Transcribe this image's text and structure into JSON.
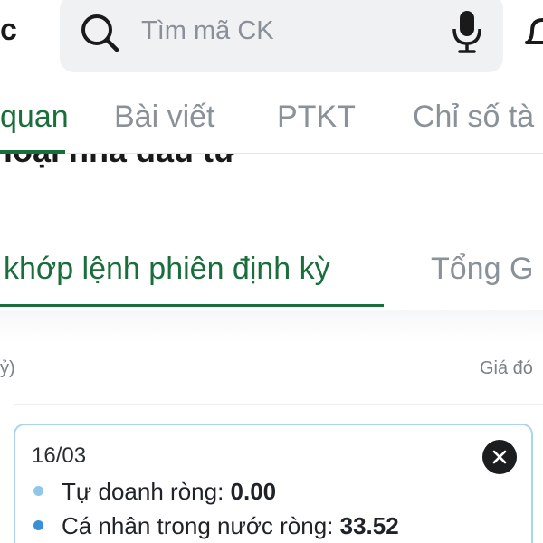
{
  "header": {
    "brand_fragment": "c",
    "search_placeholder": "Tìm mã CK",
    "icons": [
      "search-icon",
      "microphone-icon",
      "bell-icon"
    ]
  },
  "tabs": [
    {
      "label": "quan",
      "active": true
    },
    {
      "label": "Bài viết",
      "active": false
    },
    {
      "label": "PTKT",
      "active": false
    },
    {
      "label": "Chỉ số tà",
      "active": false
    }
  ],
  "section": {
    "heading": "loại nhà đầu tư"
  },
  "subtabs": [
    {
      "label": "khớp lệnh phiên định kỳ",
      "active": true
    },
    {
      "label": "Tổng G",
      "active": false
    }
  ],
  "table": {
    "left_column_label": "ỷ)",
    "right_column_label": "Giá đó"
  },
  "tooltip": {
    "date": "16/03",
    "rows": [
      {
        "label": "Tự doanh ròng: ",
        "value": "0.00",
        "color": "#8fc6ea"
      },
      {
        "label": "Cá nhân trong nước ròng: ",
        "value": "33.52",
        "color": "#3b8fd9"
      }
    ]
  },
  "colors": {
    "accent": "#1a6e3b",
    "tooltip_border": "#a9d6ee",
    "muted": "#8b9198"
  }
}
